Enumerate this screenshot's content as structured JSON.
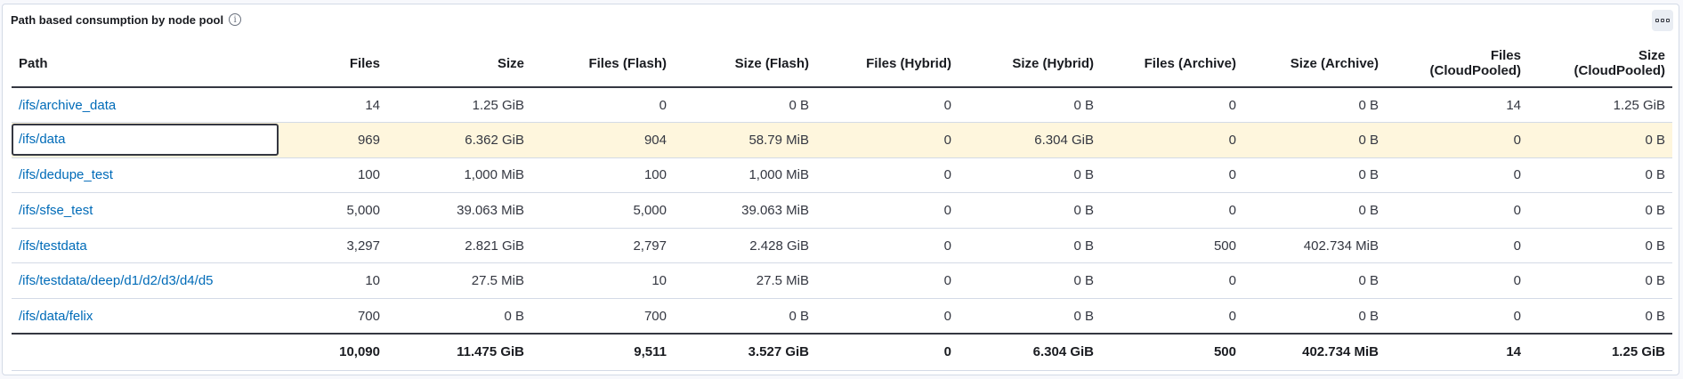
{
  "panel": {
    "title": "Path based consumption by node pool",
    "info_icon": "info-icon",
    "options_icon": "boxes-icon"
  },
  "table": {
    "columns": [
      "Path",
      "Files",
      "Size",
      "Files (Flash)",
      "Size (Flash)",
      "Files (Hybrid)",
      "Size (Hybrid)",
      "Files (Archive)",
      "Size (Archive)",
      "Files (CloudPooled)",
      "Size (CloudPooled)"
    ],
    "column_lines": [
      [
        "Path"
      ],
      [
        "Files"
      ],
      [
        "Size"
      ],
      [
        "Files (Flash)"
      ],
      [
        "Size (Flash)"
      ],
      [
        "Files (Hybrid)"
      ],
      [
        "Size (Hybrid)"
      ],
      [
        "Files (Archive)"
      ],
      [
        "Size (Archive)"
      ],
      [
        "Files",
        "(CloudPooled)"
      ],
      [
        "Size",
        "(CloudPooled)"
      ]
    ],
    "rows": [
      [
        "/ifs/archive_data",
        "14",
        "1.25 GiB",
        "0",
        "0 B",
        "0",
        "0 B",
        "0",
        "0 B",
        "14",
        "1.25 GiB"
      ],
      [
        "/ifs/data",
        "969",
        "6.362 GiB",
        "904",
        "58.79 MiB",
        "0",
        "6.304 GiB",
        "0",
        "0 B",
        "0",
        "0 B"
      ],
      [
        "/ifs/dedupe_test",
        "100",
        "1,000 MiB",
        "100",
        "1,000 MiB",
        "0",
        "0 B",
        "0",
        "0 B",
        "0",
        "0 B"
      ],
      [
        "/ifs/sfse_test",
        "5,000",
        "39.063 MiB",
        "5,000",
        "39.063 MiB",
        "0",
        "0 B",
        "0",
        "0 B",
        "0",
        "0 B"
      ],
      [
        "/ifs/testdata",
        "3,297",
        "2.821 GiB",
        "2,797",
        "2.428 GiB",
        "0",
        "0 B",
        "500",
        "402.734 MiB",
        "0",
        "0 B"
      ],
      [
        "/ifs/testdata/deep/d1/d2/d3/d4/d5",
        "10",
        "27.5 MiB",
        "10",
        "27.5 MiB",
        "0",
        "0 B",
        "0",
        "0 B",
        "0",
        "0 B"
      ],
      [
        "/ifs/data/felix",
        "700",
        "0 B",
        "700",
        "0 B",
        "0",
        "0 B",
        "0",
        "0 B",
        "0",
        "0 B"
      ]
    ],
    "highlighted_row": 1,
    "totals": [
      "",
      "10,090",
      "11.475 GiB",
      "9,511",
      "3.527 GiB",
      "0",
      "6.304 GiB",
      "500",
      "402.734 MiB",
      "14",
      "1.25 GiB"
    ]
  },
  "colors": {
    "link": "#006bb8",
    "highlight_row": "#fef6dd",
    "border": "#d3dae6",
    "text": "#343741"
  }
}
